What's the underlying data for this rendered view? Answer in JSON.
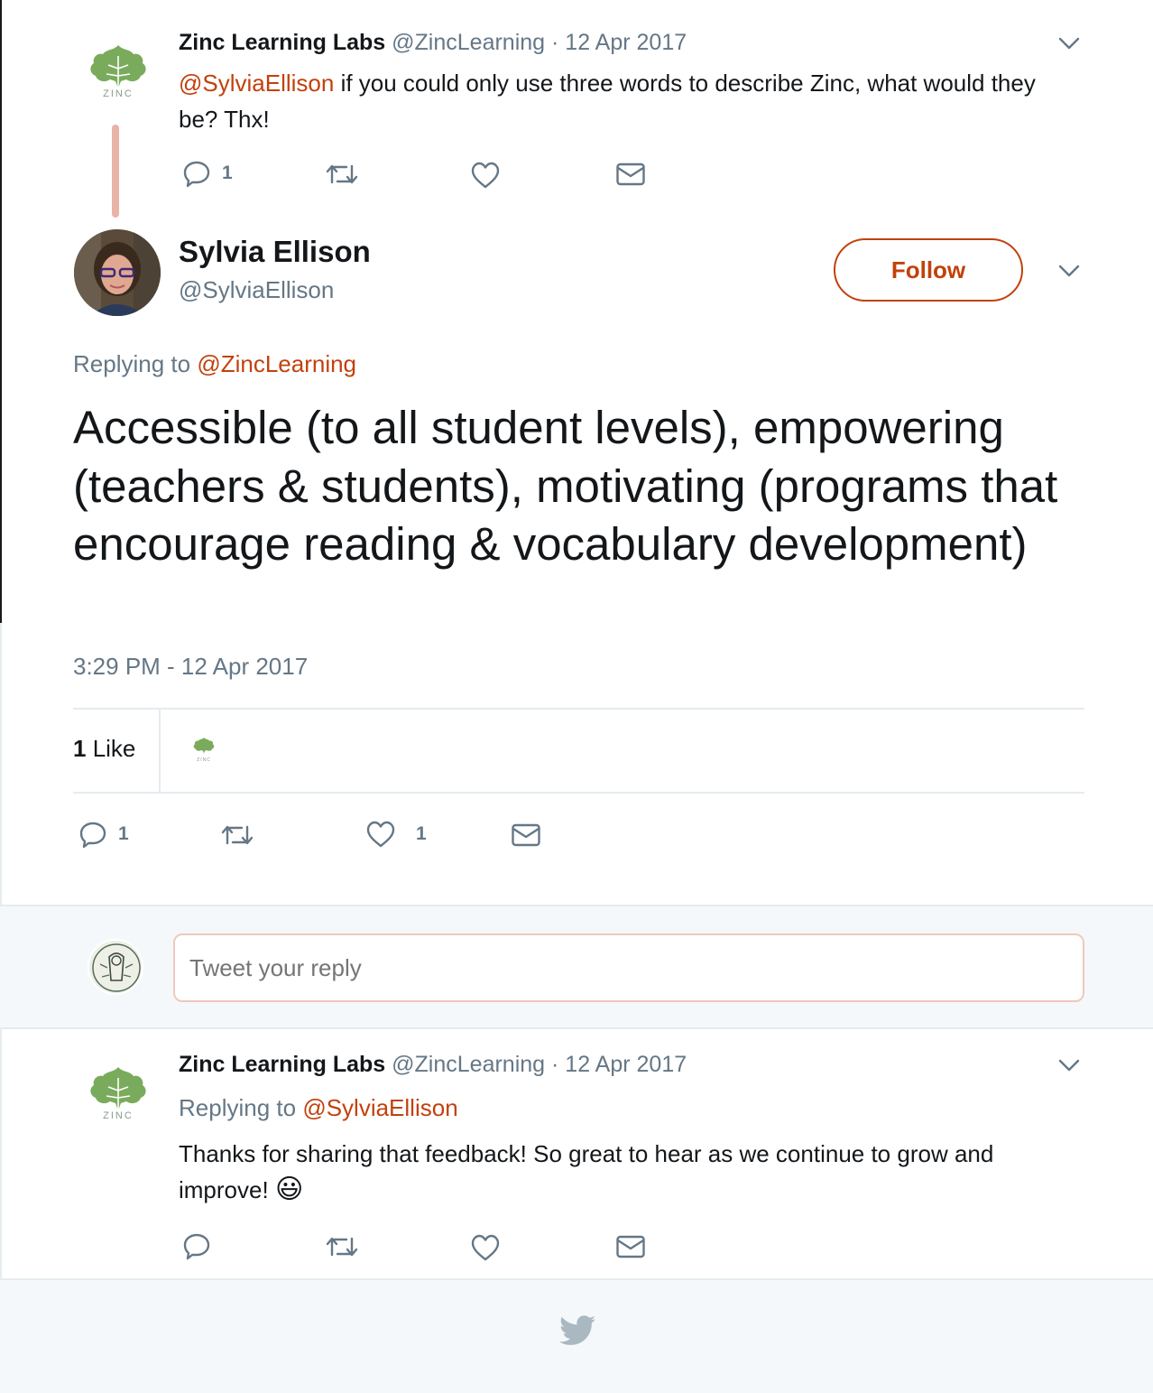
{
  "colors": {
    "accent": "#c2410c",
    "muted": "#657786",
    "thread_line": "#e8b4a8",
    "zinc_green": "#7aab5c"
  },
  "tweet1": {
    "display_name": "Zinc Learning Labs",
    "handle": "@ZincLearning",
    "date": "· 12 Apr 2017",
    "mention": "@SylviaEllison",
    "text": " if you could only use three words to describe Zinc, what would they be? Thx!",
    "avatar_text": "ZINC",
    "reply_count": "1"
  },
  "main_tweet": {
    "display_name": "Sylvia Ellison",
    "handle": "@SylviaEllison",
    "follow_label": "Follow",
    "replying_prefix": "Replying to ",
    "replying_handle": "@ZincLearning",
    "text": "Accessible (to all student levels), empowering (teachers & students), motivating (programs that encourage reading & vocabulary development)",
    "timestamp": "3:29 PM - 12 Apr 2017",
    "likes_count": "1",
    "likes_label": " Like",
    "liker_avatar_text": "ZINC",
    "reply_count": "1",
    "like_count": "1"
  },
  "reply_box": {
    "placeholder": "Tweet your reply"
  },
  "tweet3": {
    "display_name": "Zinc Learning Labs",
    "handle": "@ZincLearning",
    "date": "· 12 Apr 2017",
    "avatar_text": "ZINC",
    "replying_prefix": "Replying to ",
    "replying_handle": "@SylviaEllison",
    "text": "Thanks for sharing that feedback! So great to hear as we continue to grow and improve!",
    "emoji": "😃"
  },
  "icons": [
    "zinc-logo-icon",
    "chevron-down-icon",
    "reply-icon",
    "retweet-icon",
    "heart-icon",
    "envelope-icon",
    "twitter-bird-icon",
    "smiley-emoji-icon"
  ]
}
